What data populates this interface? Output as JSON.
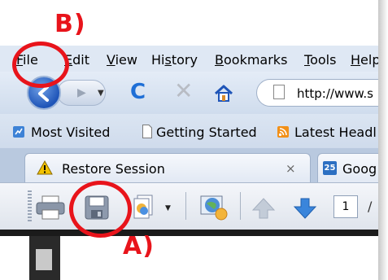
{
  "annotations": {
    "file_callout": "B)",
    "save_callout": "A)"
  },
  "menubar": {
    "items": [
      {
        "lead": "F",
        "rest": "ile"
      },
      {
        "lead": "E",
        "rest": "dit"
      },
      {
        "lead": "V",
        "rest": "iew"
      },
      {
        "lead": "Hi",
        "u": "s",
        "rest": "tory"
      },
      {
        "lead": "B",
        "rest": "ookmarks"
      },
      {
        "lead": "T",
        "rest": "ools"
      },
      {
        "lead": "H",
        "rest": "elp"
      }
    ]
  },
  "navbar": {
    "url_text": "http://www.s"
  },
  "bookmarks": {
    "items": [
      "Most Visited",
      "Getting Started",
      "Latest Headl"
    ]
  },
  "tabs": {
    "tab1_label": "Restore Session",
    "tab1_close": "×",
    "tab2_icon_text": "25",
    "tab2_label": "Goog"
  },
  "pdf_toolbar": {
    "page_number": "1",
    "page_separator": "/"
  },
  "colors": {
    "annotation": "#e8141b",
    "menubar_bg": "#dfe8f4",
    "back_button": "#1f55b8"
  }
}
